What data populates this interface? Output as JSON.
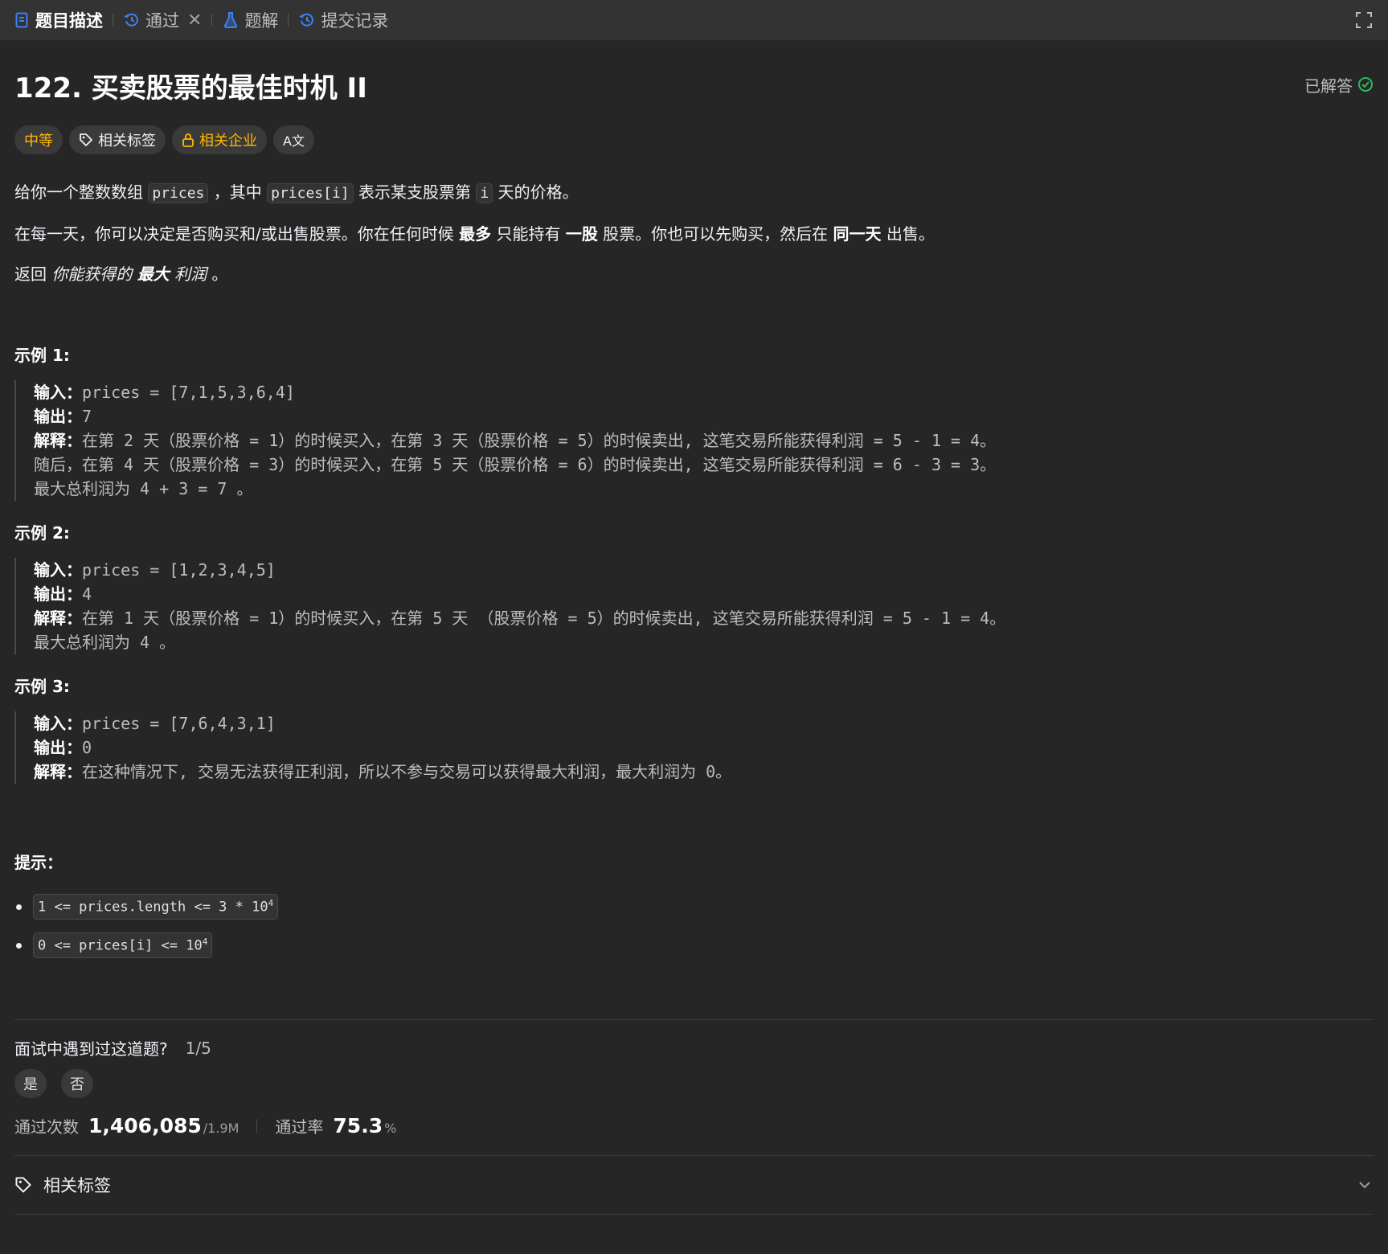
{
  "tabs": [
    {
      "label": "题目描述",
      "icon": "description-icon",
      "active": true
    },
    {
      "label": "通过",
      "icon": "history-icon",
      "closable": true
    },
    {
      "label": "题解",
      "icon": "flask-icon"
    },
    {
      "label": "提交记录",
      "icon": "history-icon"
    }
  ],
  "problem": {
    "title": "122. 买卖股票的最佳时机 II",
    "status": "已解答",
    "difficulty": "中等",
    "tags_label": "相关标签",
    "company_label": "相关企业",
    "translate_label": "A文"
  },
  "description": {
    "p1_a": "给你一个整数数组 ",
    "p1_code1": "prices",
    "p1_b": " ，其中 ",
    "p1_code2": "prices[i]",
    "p1_c": " 表示某支股票第 ",
    "p1_code3": "i",
    "p1_d": " 天的价格。",
    "p2_a": "在每一天，你可以决定是否购买和/或出售股票。你在任何时候 ",
    "p2_b1": "最多",
    "p2_c": " 只能持有 ",
    "p2_b2": "一股",
    "p2_d": " 股票。你也可以先购买，然后在 ",
    "p2_b3": "同一天",
    "p2_e": " 出售。",
    "p3_a": "返回 ",
    "p3_i1": "你能获得的 ",
    "p3_b": "最大",
    "p3_i2": " 利润",
    "p3_c": " 。"
  },
  "examples": [
    {
      "title": "示例 1:",
      "input_label": "输入：",
      "input": "prices = [7,1,5,3,6,4]",
      "output_label": "输出：",
      "output": "7",
      "explain_label": "解释：",
      "explain_lines": [
        "在第 2 天（股票价格 = 1）的时候买入，在第 3 天（股票价格 = 5）的时候卖出, 这笔交易所能获得利润 = 5 - 1 = 4。",
        "随后，在第 4 天（股票价格 = 3）的时候买入，在第 5 天（股票价格 = 6）的时候卖出, 这笔交易所能获得利润 = 6 - 3 = 3。",
        "最大总利润为 4 + 3 = 7 。"
      ]
    },
    {
      "title": "示例 2:",
      "input_label": "输入：",
      "input": "prices = [1,2,3,4,5]",
      "output_label": "输出：",
      "output": "4",
      "explain_label": "解释：",
      "explain_lines": [
        "在第 1 天（股票价格 = 1）的时候买入，在第 5 天 （股票价格 = 5）的时候卖出, 这笔交易所能获得利润 = 5 - 1 = 4。",
        "最大总利润为 4 。"
      ]
    },
    {
      "title": "示例 3:",
      "input_label": "输入：",
      "input": "prices = [7,6,4,3,1]",
      "output_label": "输出：",
      "output": "0",
      "explain_label": "解释：",
      "explain_lines": [
        "在这种情况下, 交易无法获得正利润，所以不参与交易可以获得最大利润，最大利润为 0。"
      ]
    }
  ],
  "hints": {
    "title": "提示：",
    "items": [
      {
        "text": "1 <= prices.length <= 3 * 10",
        "sup": "4"
      },
      {
        "text": "0 <= prices[i] <= 10",
        "sup": "4"
      }
    ]
  },
  "interview": {
    "question": "面试中遇到过这道题?",
    "count": "1/5",
    "yes": "是",
    "no": "否"
  },
  "stats": {
    "accepted_label": "通过次数",
    "accepted_value": "1,406,085",
    "submissions": "/1.9M",
    "rate_label": "通过率",
    "rate_value": "75.3",
    "rate_unit": "%"
  },
  "related_tags_label": "相关标签"
}
